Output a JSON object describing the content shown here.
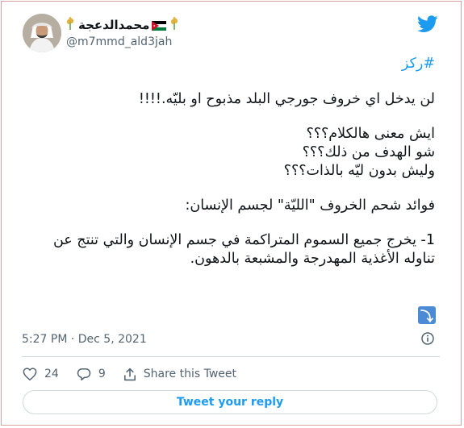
{
  "author": {
    "display_name": "محمدالدعجة",
    "handle": "@m7mmd_ald3jah",
    "name_emojis": [
      "wheat",
      "jordan-flag",
      "wheat"
    ]
  },
  "tweet": {
    "hashtag": "#ركز",
    "paragraphs": [
      "لن يدخل اي خروف جورجي البلد مذبوح او بليّه.!!!!",
      "ايش معنى هالكلام؟؟؟\nشو الهدف من ذلك؟؟؟\nوليش بدون ليّه بالذات؟؟؟",
      "فوائد شحم الخروف \"الليّة\" لجسم الإنسان:",
      "1- يخرج جميع السموم المتراكمة في جسم الإنسان والتي تنتج عن تناوله الأغذية المهدرجة والمشبعة بالدهون."
    ],
    "timestamp": "5:27 PM · Dec 5, 2021"
  },
  "actions": {
    "likes": "24",
    "replies": "9",
    "share_label": "Share this Tweet",
    "reply_button": "Tweet your reply"
  },
  "colors": {
    "accent": "#1d9bf0",
    "text": "#0f1419",
    "muted": "#536471",
    "border": "#cfd9de"
  }
}
